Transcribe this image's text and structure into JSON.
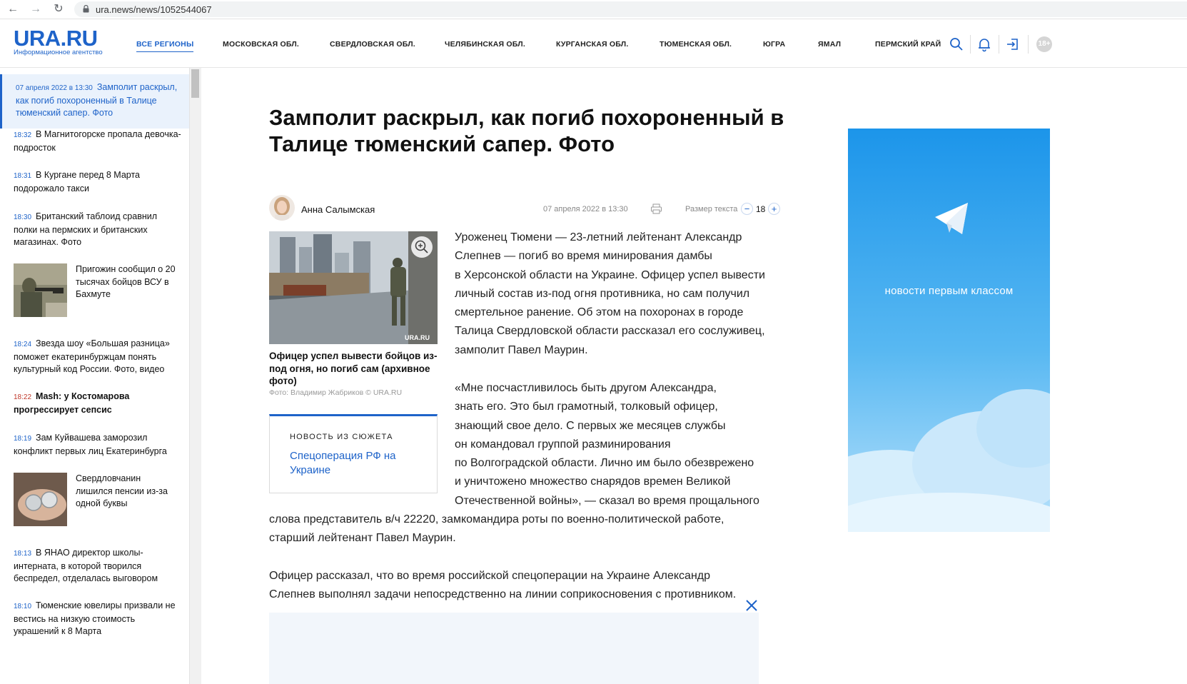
{
  "browser": {
    "url": "ura.news/news/1052544067"
  },
  "header": {
    "logo_name": "URA.RU",
    "logo_sub": "Информационное агентство",
    "nav": [
      "ВСЕ РЕГИОНЫ",
      "МОСКОВСКАЯ ОБЛ.",
      "СВЕРДЛОВСКАЯ ОБЛ.",
      "ЧЕЛЯБИНСКАЯ ОБЛ.",
      "КУРГАНСКАЯ ОБЛ.",
      "ТЮМЕНСКАЯ ОБЛ.",
      "ЮГРА",
      "ЯМАЛ",
      "ПЕРМСКИЙ КРАЙ"
    ],
    "age_badge": "18+"
  },
  "feed": [
    {
      "time": "07 апреля 2022 в 13:30",
      "text": "Замполит раскрыл, как погиб похороненный в Талице тюменский сапер. Фото"
    },
    {
      "time": "18:32",
      "text": "В Магнитогорске пропала девочка-подросток"
    },
    {
      "time": "18:31",
      "text": "В Кургане перед 8 Марта подорожало такси"
    },
    {
      "time": "18:30",
      "text": "Британский таблоид сравнил полки на пермских и британских магазинах. Фото"
    },
    {
      "time": "",
      "text": "Пригожин сообщил о 20 тысячах бойцов ВСУ в Бахмуте"
    },
    {
      "time": "18:24",
      "text": "Звезда шоу «Большая разница» поможет екатеринбуржцам понять культурный код России. Фото, видео"
    },
    {
      "time": "18:22",
      "text": "Mash: у Костомарова прогрессирует сепсис"
    },
    {
      "time": "18:19",
      "text": "Зам Куйвашева заморозил конфликт первых лиц Екатеринбурга"
    },
    {
      "time": "",
      "text": "Свердловчанин лишился пенсии из-за одной буквы"
    },
    {
      "time": "18:13",
      "text": "В ЯНАО директор школы-интерната, в которой творился беспредел, отделалась выговором"
    },
    {
      "time": "18:10",
      "text": "Тюменские ювелиры призвали не вестись на низкую стоимость украшений к 8 Марта"
    }
  ],
  "article": {
    "title": "Замполит раскрыл, как погиб похороненный в Талице тюменский сапер. Фото",
    "author": "Анна Салымская",
    "date": "07 апреля 2022 в 13:30",
    "text_size_label": "Размер текста",
    "text_size_value": "18",
    "photo_watermark": "URA.RU",
    "caption": "Офицер успел вывести бойцов из-под огня, но погиб сам (архивное фото)",
    "photo_credit": "Фото: Владимир Жабриков © URA.RU",
    "story_label": "НОВОСТЬ ИЗ СЮЖЕТА",
    "story_link": "Спецоперация РФ на Украине",
    "paragraphs": [
      [
        "Уроженец Тюмени — 23-летний лейтенант Александр",
        "Слепнев — погиб во время минирования дамбы",
        "в Херсонской области на Украине. Офицер успел вывести",
        "личный состав из-под огня противника, но сам получил",
        "смертельное ранение. Об этом на похоронах в городе",
        "Талица Свердловской области рассказал его сослуживец,",
        "замполит Павел Маурин."
      ],
      [
        "«Мне посчастливилось быть другом Александра,",
        "знать его. Это был грамотный, толковый офицер,",
        "знающий свое дело. С первых же месяцев службы",
        "он командовал группой разминирования",
        "по Волгоградской области. Лично им было обезврежено",
        "и уничтожено множество снарядов времен Великой",
        "Отечественной войны», — сказал во время прощального"
      ],
      [
        "слова представитель в/ч 22220, замкомандира роты по военно-политической работе,",
        "старший лейтенант Павел Маурин."
      ],
      [
        "Офицер рассказал, что во время российской спецоперации на Украине Александр",
        "Слепнев выполнял задачи непосредственно на линии соприкосновения с противником."
      ]
    ]
  },
  "ad": {
    "text": "новости первым классом"
  },
  "colors": {
    "brand": "#1e63c9",
    "hot_time": "#c0392b"
  }
}
